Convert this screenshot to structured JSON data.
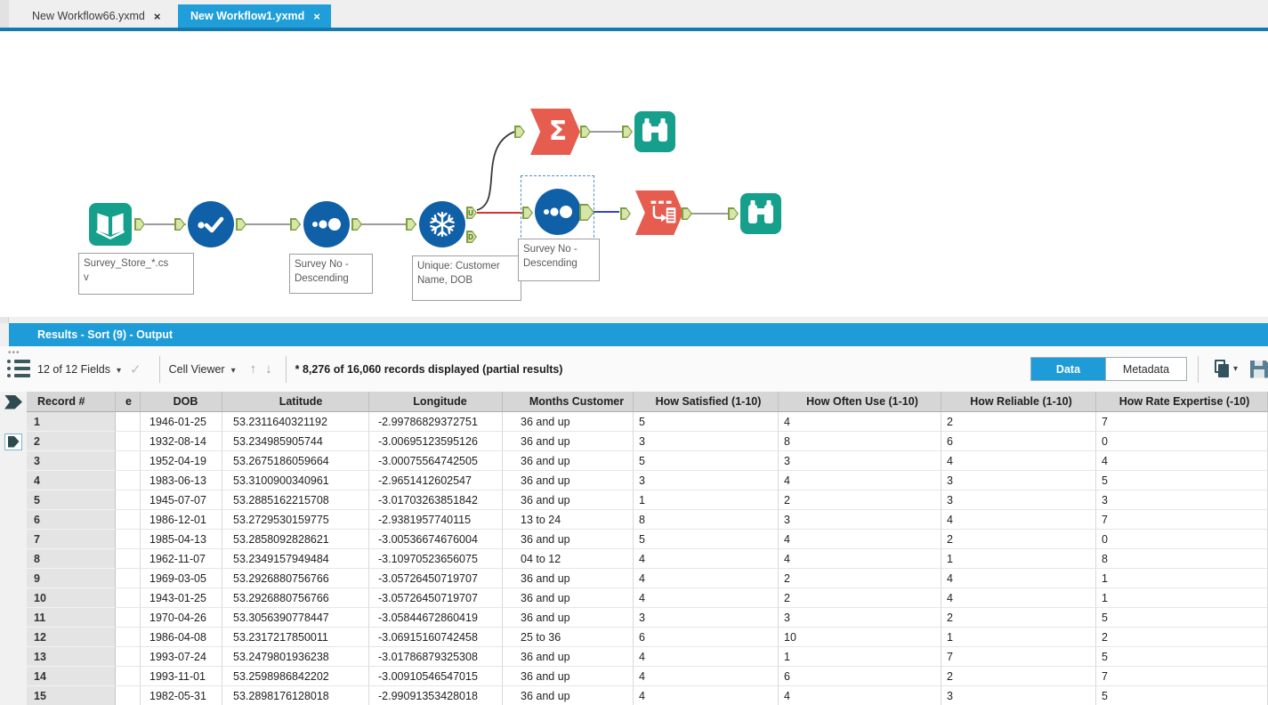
{
  "window": {
    "tabs": [
      {
        "label": "New Workflow66.yxmd",
        "close": "×",
        "active": false
      },
      {
        "label": "New Workflow1.yxmd",
        "close": "×",
        "active": true
      }
    ]
  },
  "canvas": {
    "tools": {
      "input": {
        "label": "Survey_Store_*.cs\nv"
      },
      "sort1": {
        "label": "Survey No -\nDescending"
      },
      "unique": {
        "label": "Unique: Customer\nName, DOB",
        "out_top": "U",
        "out_bottom": "D"
      },
      "sort2": {
        "label": "Survey No -\nDescending",
        "selected": true
      },
      "summarize": {
        "glyph": "Σ"
      }
    }
  },
  "results": {
    "title": "Results - Sort (9) - Output",
    "toolbar": {
      "fields_dropdown": "12 of 12 Fields",
      "cell_viewer_dropdown": "Cell Viewer",
      "records_summary": "* 8,276 of 16,060 records displayed (partial results)",
      "data_tab": "Data",
      "metadata_tab": "Metadata"
    },
    "table": {
      "columns": [
        "Record #",
        "e",
        "DOB",
        "Latitude",
        "Longitude",
        "Months Customer",
        "How Satisfied (1-10)",
        "How Often Use (1-10)",
        "How Reliable (1-10)",
        "How Rate Expertise (-10)"
      ],
      "rows": [
        [
          "1",
          "1946-01-25",
          "53.2311640321192",
          "-2.99786829372751",
          "36 and up",
          "5",
          "4",
          "2",
          "7"
        ],
        [
          "2",
          "1932-08-14",
          "53.234985905744",
          "-3.00695123595126",
          "36 and up",
          "3",
          "8",
          "6",
          "0"
        ],
        [
          "3",
          "1952-04-19",
          "53.2675186059664",
          "-3.00075564742505",
          "36 and up",
          "5",
          "3",
          "4",
          "4"
        ],
        [
          "4",
          "1983-06-13",
          "53.3100900340961",
          "-2.9651412602547",
          "36 and up",
          "3",
          "4",
          "3",
          "5"
        ],
        [
          "5",
          "1945-07-07",
          "53.2885162215708",
          "-3.01703263851842",
          "36 and up",
          "1",
          "2",
          "3",
          "3"
        ],
        [
          "6",
          "1986-12-01",
          "53.2729530159775",
          "-2.9381957740115",
          "13 to 24",
          "8",
          "3",
          "4",
          "7"
        ],
        [
          "7",
          "1985-04-13",
          "53.2858092828621",
          "-3.00536674676004",
          "36 and up",
          "5",
          "4",
          "2",
          "0"
        ],
        [
          "8",
          "1962-11-07",
          "53.2349157949484",
          "-3.10970523656075",
          "04 to 12",
          "4",
          "4",
          "1",
          "8"
        ],
        [
          "9",
          "1969-03-05",
          "53.2926880756766",
          "-3.05726450719707",
          "36 and up",
          "4",
          "2",
          "4",
          "1"
        ],
        [
          "10",
          "1943-01-25",
          "53.2926880756766",
          "-3.05726450719707",
          "36 and up",
          "4",
          "2",
          "4",
          "1"
        ],
        [
          "11",
          "1970-04-26",
          "53.3056390778447",
          "-3.05844672860419",
          "36 and up",
          "3",
          "3",
          "2",
          "5"
        ],
        [
          "12",
          "1986-04-08",
          "53.2317217850011",
          "-3.06915160742458",
          "25 to 36",
          "6",
          "10",
          "1",
          "2"
        ],
        [
          "13",
          "1993-07-24",
          "53.2479801936238",
          "-3.01786879325308",
          "36 and up",
          "4",
          "1",
          "7",
          "5"
        ],
        [
          "14",
          "1993-11-01",
          "53.2598986842202",
          "-3.00910546547015",
          "36 and up",
          "4",
          "6",
          "2",
          "7"
        ],
        [
          "15",
          "1982-05-31",
          "53.2898176128018",
          "-2.99091353428018",
          "36 and up",
          "4",
          "4",
          "3",
          "5"
        ]
      ]
    }
  },
  "colors": {
    "accent_blue": "#1e9cd7",
    "tab_underline": "#1379ae",
    "tool_blue": "#1060a8",
    "tool_teal": "#16a08c",
    "tool_orange": "#e65c4f",
    "wire_red": "#e03030",
    "wire_blue": "#3a43c4",
    "anchor_green": "#d5e6a8"
  }
}
